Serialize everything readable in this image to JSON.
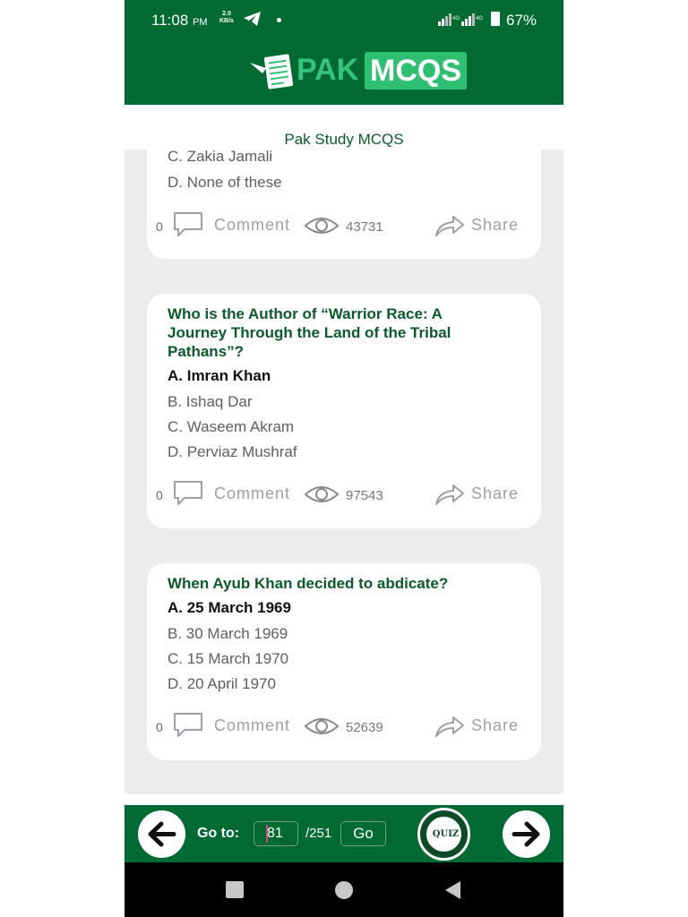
{
  "status_bar": {
    "time": "11:08",
    "ampm": "PM",
    "speed_value": "2.0",
    "speed_unit": "KB/s",
    "battery": "67%"
  },
  "header": {
    "logo_pak": "PAK",
    "logo_mcqs": "MCQS",
    "subtitle": "Pak Study MCQS"
  },
  "cards": [
    {
      "options": [
        "C. Zakia Jamali",
        "D. None of these"
      ],
      "comment_count": "0",
      "comment_label": "Comment",
      "views": "43731",
      "share_label": "Share"
    },
    {
      "question": "Who is the Author of “Warrior Race: A Journey Through the Land of the Tribal Pathans”?",
      "answer": "A. Imran Khan",
      "options": [
        "B. Ishaq Dar",
        "C. Waseem Akram",
        "D. Perviaz Mushraf"
      ],
      "comment_count": "0",
      "comment_label": "Comment",
      "views": "97543",
      "share_label": "Share"
    },
    {
      "question": "When Ayub Khan decided to abdicate?",
      "answer": "A. 25 March 1969",
      "options": [
        "B. 30 March 1969",
        "C. 15 March 1970",
        "D. 20 April 1970"
      ],
      "comment_count": "0",
      "comment_label": "Comment",
      "views": "52639",
      "share_label": "Share"
    }
  ],
  "bottom_bar": {
    "goto_label": "Go to:",
    "page_value": "81",
    "total_pages": "/251",
    "go_label": "Go",
    "quiz_label": "QUIZ"
  },
  "colors": {
    "brand_green": "#006a33",
    "question_green": "#0b5a2d",
    "logo_green": "#2fbf73"
  },
  "icons": [
    "telegram-icon",
    "signal-icon",
    "battery-icon",
    "comment-icon",
    "eye-icon",
    "share-icon",
    "arrow-left-icon",
    "arrow-right-icon",
    "quiz-icon"
  ]
}
